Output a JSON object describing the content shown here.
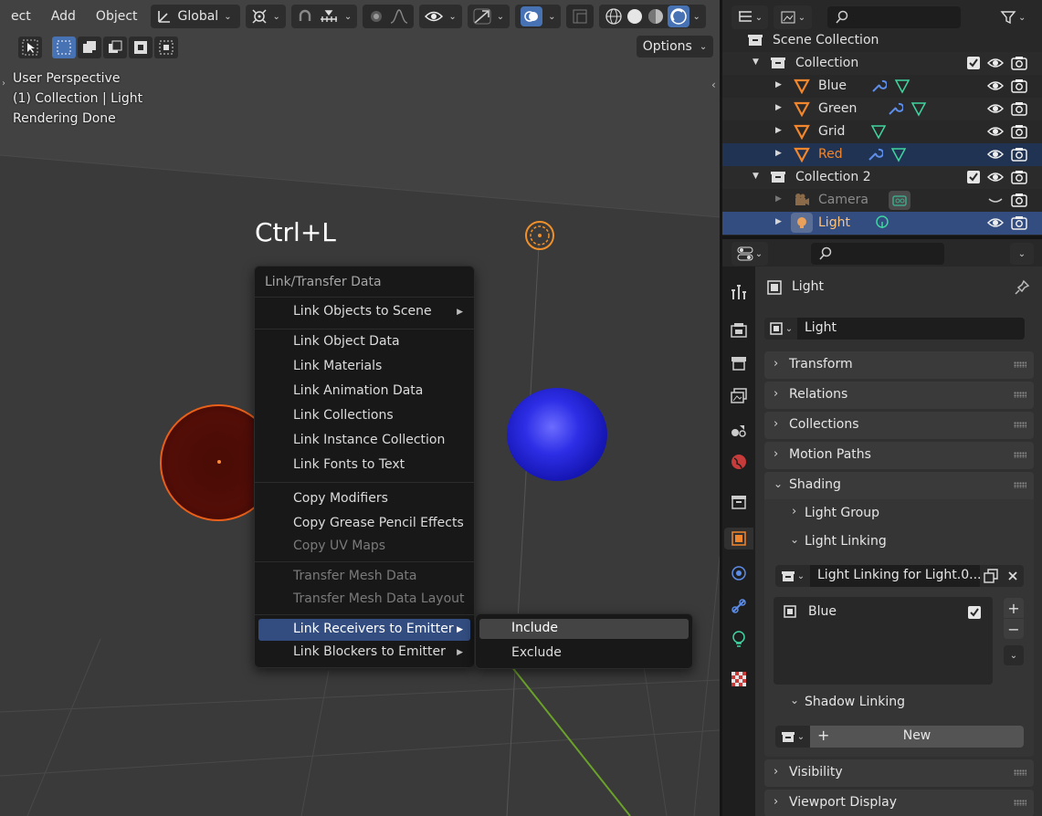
{
  "viewport": {
    "menus": [
      "ect",
      "Add",
      "Object"
    ],
    "orientation": "Global",
    "options_label": "Options",
    "overlay": {
      "line1": "User Perspective",
      "line2": "(1) Collection | Light",
      "line3": "Rendering Done"
    },
    "shortcut": "Ctrl+L",
    "context_menu": {
      "title": "Link/Transfer Data",
      "items": [
        {
          "label": "Link Objects to Scene",
          "submenu": true
        },
        {
          "label": "Link Object Data"
        },
        {
          "label": "Link Materials"
        },
        {
          "label": "Link Animation Data"
        },
        {
          "label": "Link Collections"
        },
        {
          "label": "Link Instance Collection"
        },
        {
          "label": "Link Fonts to Text"
        },
        {
          "label": "Copy Modifiers"
        },
        {
          "label": "Copy Grease Pencil Effects"
        },
        {
          "label": "Copy UV Maps",
          "disabled": true
        },
        {
          "label": "Transfer Mesh Data",
          "disabled": true
        },
        {
          "label": "Transfer Mesh Data Layout",
          "disabled": true
        },
        {
          "label": "Link Receivers to Emitter",
          "submenu": true,
          "highlighted": true
        },
        {
          "label": "Link Blockers to Emitter",
          "submenu": true
        }
      ],
      "submenu_items": [
        "Include",
        "Exclude"
      ]
    }
  },
  "outliner": {
    "rows": [
      {
        "label": "Scene Collection"
      },
      {
        "label": "Collection"
      },
      {
        "label": "Blue"
      },
      {
        "label": "Green"
      },
      {
        "label": "Grid"
      },
      {
        "label": "Red"
      },
      {
        "label": "Collection 2"
      },
      {
        "label": "Camera"
      },
      {
        "label": "Light"
      }
    ]
  },
  "properties": {
    "object_name": "Light",
    "name_field": "Light",
    "panels": {
      "transform": "Transform",
      "relations": "Relations",
      "collections": "Collections",
      "motion_paths": "Motion Paths",
      "shading": "Shading",
      "light_group": "Light Group",
      "light_linking": "Light Linking",
      "shadow_linking": "Shadow Linking",
      "visibility": "Visibility",
      "viewport_display": "Viewport Display"
    },
    "light_linking_collection": "Light Linking for Light.0...",
    "light_linking_items": [
      {
        "label": "Blue",
        "checked": true
      }
    ],
    "new_button": "New"
  },
  "colors": {
    "selection_blue": "#334d80",
    "accent_blue": "#4772b3",
    "selected_orange": "#f1862c",
    "active_orange": "#ffc37a"
  }
}
